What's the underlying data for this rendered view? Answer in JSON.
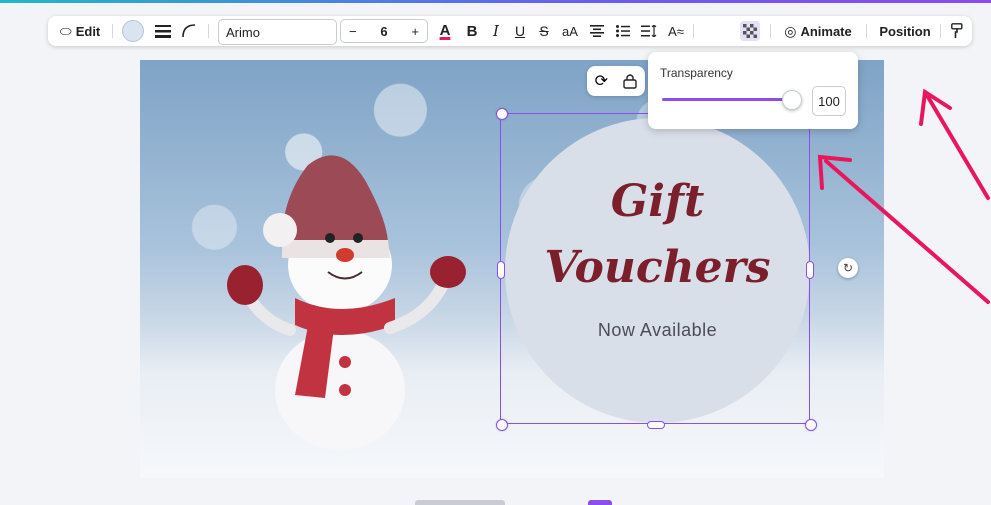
{
  "toolbar": {
    "edit_label": "Edit",
    "font_name": "Arimo",
    "font_size_minus": "−",
    "font_size_value": "6",
    "font_size_plus": "+",
    "text_color_glyph": "A",
    "bold_glyph": "B",
    "italic_glyph": "I",
    "underline_glyph": "U",
    "strike_glyph": "S",
    "case_glyph": "aA",
    "animate_label": "Animate",
    "position_label": "Position"
  },
  "design": {
    "title_line1": "Gift",
    "title_line2": "Vouchers",
    "subtitle": "Now Available"
  },
  "transparency": {
    "label": "Transparency",
    "value": "100",
    "level_percent": 100
  },
  "colors": {
    "accent": "#8b4cf0",
    "title_color": "#7a1f2b",
    "circle_fill": "#d9dfe9",
    "annotation_arrow": "#e8175d"
  },
  "icons": [
    "shape-edit-icon",
    "color-swatch-icon",
    "line-weight-icon",
    "corner-icon",
    "text-color-icon",
    "bold-icon",
    "italic-icon",
    "underline-icon",
    "strikethrough-icon",
    "case-icon",
    "align-icon",
    "list-icon",
    "spacing-icon",
    "text-effects-icon",
    "transparency-icon",
    "animate-icon",
    "paint-format-icon",
    "comment-plus-icon",
    "lock-icon",
    "rotate-icon"
  ]
}
